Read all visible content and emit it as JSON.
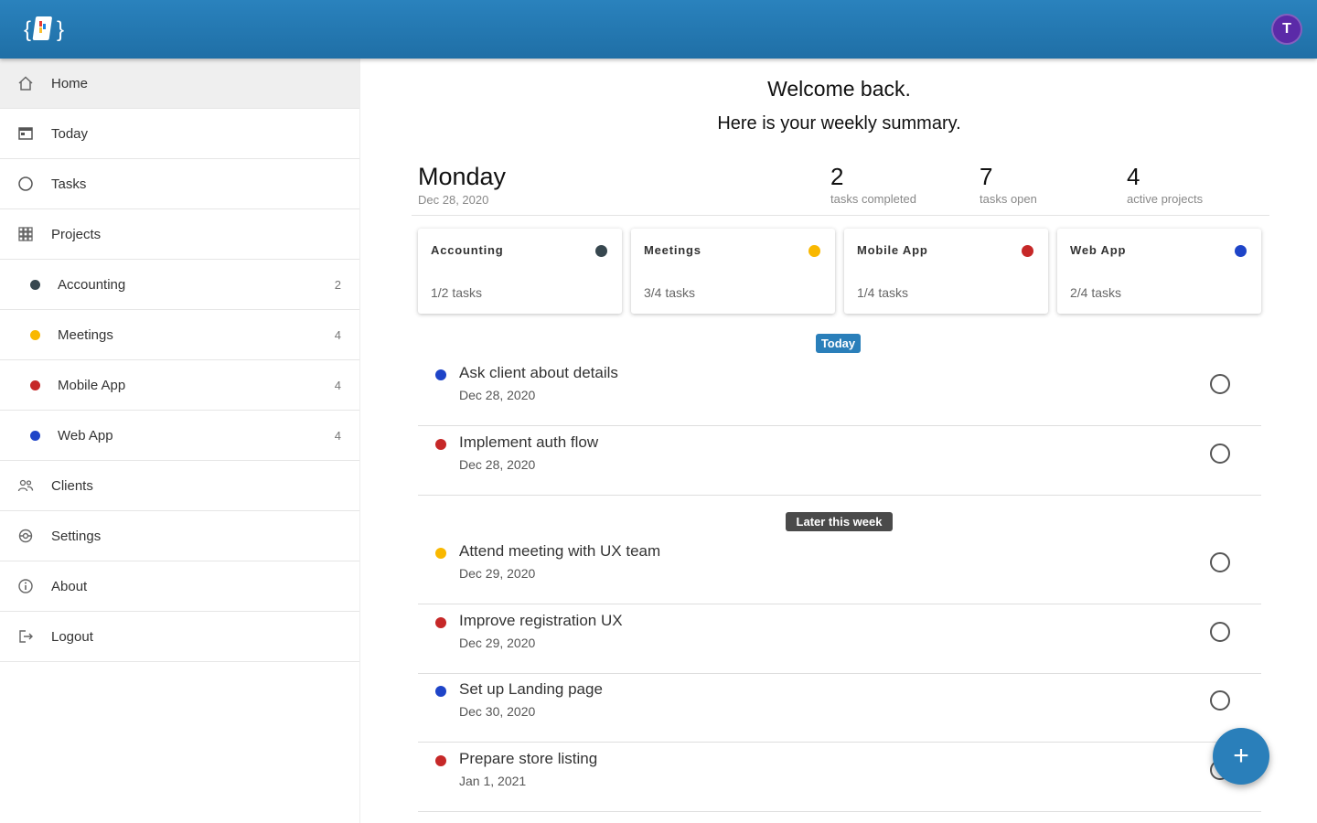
{
  "app": {
    "avatar_letter": "T",
    "avatar_color": "#5b2aa8"
  },
  "sidebar": {
    "items": [
      {
        "label": "Home",
        "icon": "home-icon"
      },
      {
        "label": "Today",
        "icon": "calendar-today-icon"
      },
      {
        "label": "Tasks",
        "icon": "circle-icon"
      },
      {
        "label": "Projects",
        "icon": "grid-icon"
      },
      {
        "label": "Accounting",
        "count": "2",
        "color": "#37474f"
      },
      {
        "label": "Meetings",
        "count": "4",
        "color": "#f9b800"
      },
      {
        "label": "Mobile App",
        "count": "4",
        "color": "#c62828"
      },
      {
        "label": "Web App",
        "count": "4",
        "color": "#1e44c8"
      },
      {
        "label": "Clients",
        "icon": "people-icon"
      },
      {
        "label": "Settings",
        "icon": "gear-icon"
      },
      {
        "label": "About",
        "icon": "info-icon"
      },
      {
        "label": "Logout",
        "icon": "logout-icon"
      }
    ]
  },
  "main": {
    "welcome": "Welcome back.",
    "weekly": "Here is your weekly summary.",
    "day": "Monday",
    "date": "Dec 28, 2020",
    "stats": [
      {
        "value": "2",
        "label": "tasks completed"
      },
      {
        "value": "7",
        "label": "tasks open"
      },
      {
        "value": "4",
        "label": "active projects"
      }
    ],
    "projects": [
      {
        "name": "Accounting",
        "tasks": "1/2 tasks",
        "color": "#37474f"
      },
      {
        "name": "Meetings",
        "tasks": "3/4 tasks",
        "color": "#f9b800"
      },
      {
        "name": "Mobile App",
        "tasks": "1/4 tasks",
        "color": "#c62828"
      },
      {
        "name": "Web App",
        "tasks": "2/4 tasks",
        "color": "#1e44c8"
      }
    ],
    "sections": [
      {
        "label": "Today",
        "color": "#2a7fba"
      },
      {
        "label": "Later this week",
        "color": "#4a4a4a"
      }
    ],
    "tasks": [
      {
        "title": "Ask client about details",
        "date": "Dec 28, 2020",
        "color": "#1e44c8"
      },
      {
        "title": "Implement auth flow",
        "date": "Dec 28, 2020",
        "color": "#c62828"
      },
      {
        "title": "Attend meeting with UX team",
        "date": "Dec 29, 2020",
        "color": "#f9b800"
      },
      {
        "title": "Improve registration UX",
        "date": "Dec 29, 2020",
        "color": "#c62828"
      },
      {
        "title": "Set up Landing page",
        "date": "Dec 30, 2020",
        "color": "#1e44c8"
      },
      {
        "title": "Prepare store listing",
        "date": "Jan 1, 2021",
        "color": "#c62828"
      }
    ]
  },
  "fab": {
    "symbol": "+"
  }
}
